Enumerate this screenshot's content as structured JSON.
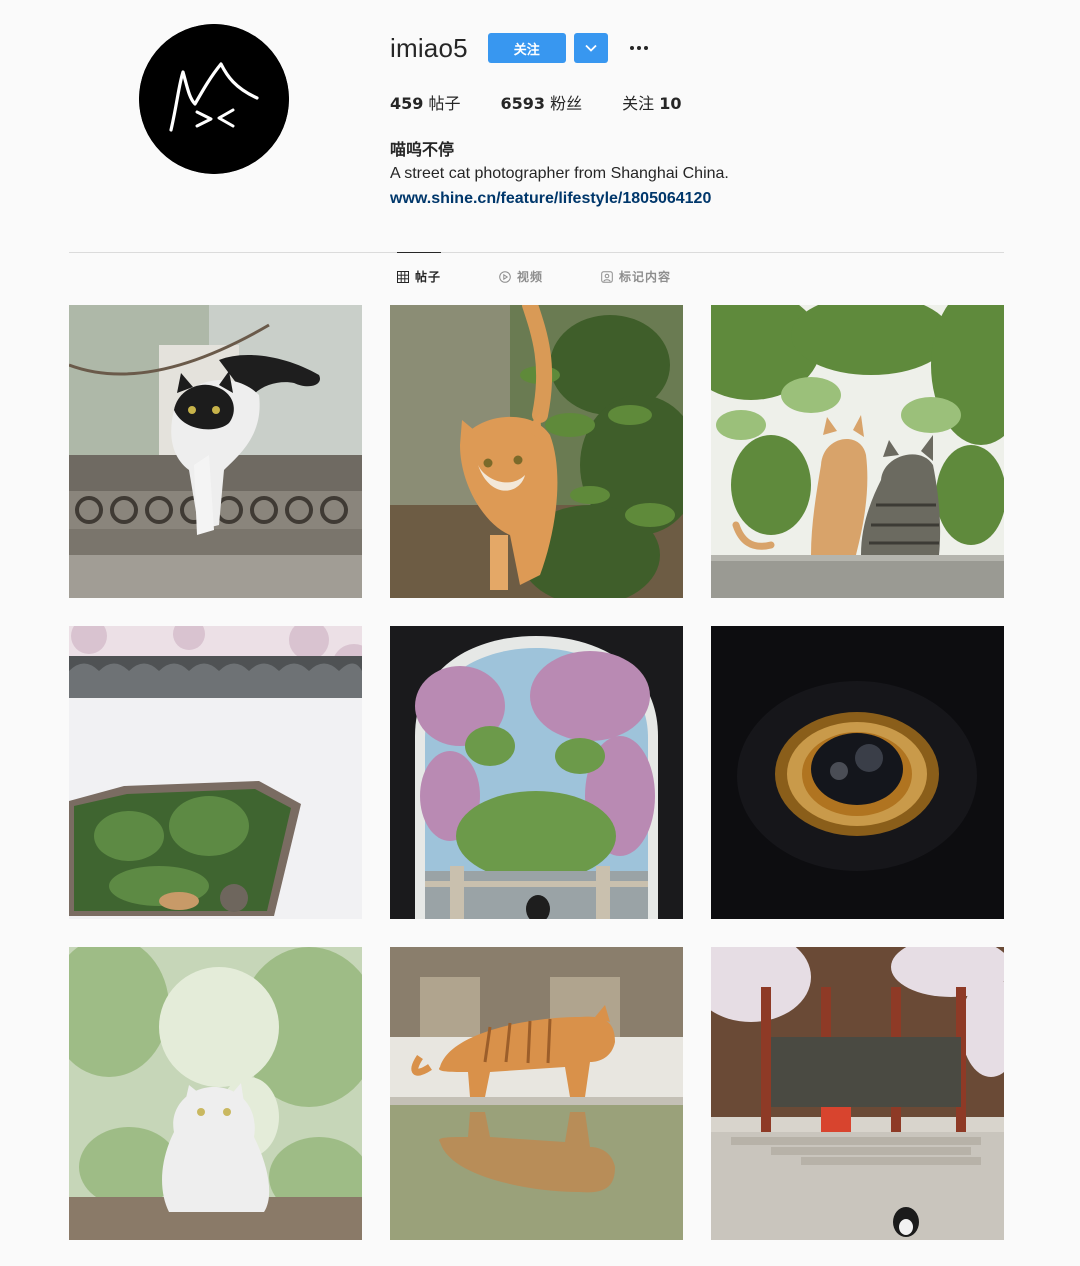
{
  "profile": {
    "username": "imiao5",
    "follow_label": "关注",
    "stats": [
      {
        "count": "459",
        "label": "帖子"
      },
      {
        "count": "6593",
        "label": "粉丝"
      },
      {
        "prefix": "关注",
        "count": "10"
      }
    ],
    "name": "喵呜不停",
    "description": "A street cat photographer from Shanghai China.",
    "link": "www.shine.cn/feature/lifestyle/1805064120"
  },
  "tabs": [
    {
      "label": "帖子",
      "icon": "grid-icon",
      "active": true
    },
    {
      "label": "视频",
      "icon": "play-icon",
      "active": false
    },
    {
      "label": "标记内容",
      "icon": "tag-icon",
      "active": false
    }
  ],
  "posts": [
    {
      "subject": "black-white-cat-jumping-off-wall"
    },
    {
      "subject": "orange-cat-walking-through-plants"
    },
    {
      "subject": "two-cats-sitting-on-stone-ledge"
    },
    {
      "subject": "cats-through-window-in-white-wall"
    },
    {
      "subject": "cat-in-arched-doorway-with-blossoms"
    },
    {
      "subject": "close-up-cat-eye"
    },
    {
      "subject": "white-fluffy-cat-in-garden"
    },
    {
      "subject": "tabby-cat-walking-with-reflection"
    },
    {
      "subject": "black-white-cat-in-pavilion-courtyard"
    }
  ],
  "colors": {
    "accent": "#3897f0",
    "link": "#00376b",
    "text": "#262626",
    "muted": "#8e8e8e",
    "divider": "#dbdbdb"
  }
}
